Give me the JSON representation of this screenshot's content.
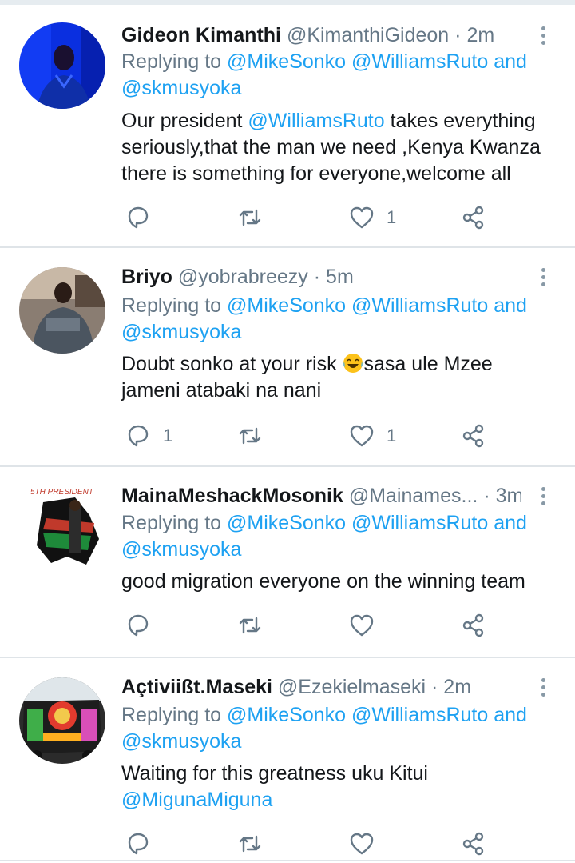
{
  "tweets": [
    {
      "name": "Gideon  Kimanthi",
      "handle": "@KimanthiGideon",
      "dot": "·",
      "time": "2m",
      "replying_prefix": "Replying to",
      "replying_to": "@MikeSonko @WilliamsRuto and @skmusyoka",
      "text_parts": [
        "Our president ",
        "@WilliamsRuto",
        " takes everything seriously,that the man we need ,Kenya Kwanza there is something for everyone,welcome all"
      ],
      "reply_count": "",
      "retweet_count": "",
      "like_count": "1"
    },
    {
      "name": "Briyo",
      "handle": "@yobrabreezy",
      "dot": "·",
      "time": "5m",
      "replying_prefix": "Replying to",
      "replying_to": "@MikeSonko @WilliamsRuto and @skmusyoka",
      "text_parts": [
        "Doubt sonko at your risk ",
        "sasa ule Mzee jameni atabaki na nani"
      ],
      "emoji": "face-with-tears-of-joy",
      "reply_count": "1",
      "retweet_count": "",
      "like_count": "1"
    },
    {
      "name": "MainaMeshackMosonik",
      "handle": "@Mainames...",
      "dot": "·",
      "time": "3m",
      "replying_prefix": "Replying to",
      "replying_to": "@MikeSonko @WilliamsRuto and @skmusyoka",
      "text": "good migration everyone on the winning team",
      "avatar_text": "5TH PRESIDENT",
      "reply_count": "",
      "retweet_count": "",
      "like_count": ""
    },
    {
      "name": "Açtiviißt.Maseki",
      "handle": "@Ezekielmaseki",
      "dot": "·",
      "time": "2m",
      "replying_prefix": "Replying to",
      "replying_to": "@MikeSonko @WilliamsRuto and @skmusyoka",
      "text": "Waiting for this greatness uku Kitui",
      "text_mention": "@MigunaMiguna",
      "reply_count": "",
      "retweet_count": "",
      "like_count": ""
    }
  ],
  "colors": {
    "link": "#1da1f2",
    "secondary": "#657786",
    "divider": "#dfe4e8"
  },
  "icons": [
    "reply-icon",
    "retweet-icon",
    "like-icon",
    "share-icon",
    "more-icon"
  ]
}
